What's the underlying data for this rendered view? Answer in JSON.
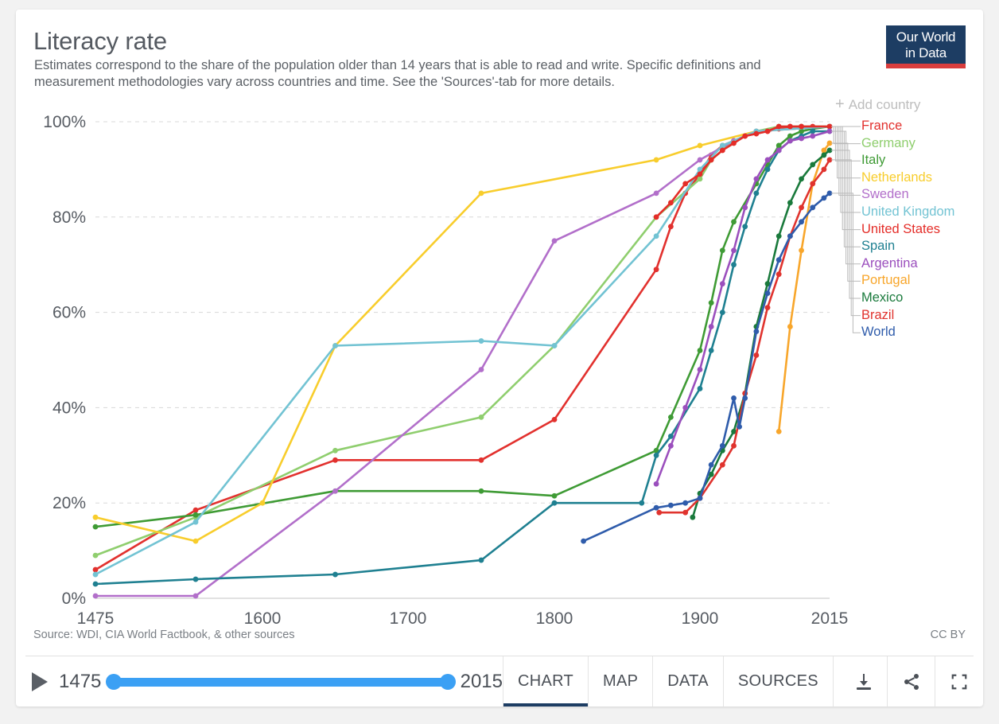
{
  "header": {
    "title": "Literacy rate",
    "subtitle": "Estimates correspond to the share of the population older than 14 years that is able to read and write. Specific definitions and measurement methodologies vary across countries and time. See the 'Sources'-tab for more details.",
    "logo_line1": "Our World",
    "logo_line2": "in Data"
  },
  "legend": {
    "add_country_label": "Add country",
    "add_icon": "plus-icon"
  },
  "footer": {
    "source": "Source: WDI, CIA World Factbook, & other sources",
    "license": "CC BY"
  },
  "controls": {
    "play_icon": "play-icon",
    "start_year": "1475",
    "end_year": "2015",
    "tabs": [
      {
        "label": "CHART",
        "active": true
      },
      {
        "label": "MAP",
        "active": false
      },
      {
        "label": "DATA",
        "active": false
      },
      {
        "label": "SOURCES",
        "active": false
      }
    ],
    "icons": [
      {
        "name": "download-icon"
      },
      {
        "name": "share-icon"
      },
      {
        "name": "fullscreen-icon"
      }
    ]
  },
  "chart_data": {
    "type": "line",
    "title": "Literacy rate",
    "xlabel": "",
    "ylabel": "",
    "xlim": [
      1475,
      2015
    ],
    "ylim": [
      0,
      100
    ],
    "grid": true,
    "legend_position": "right",
    "x_ticks": [
      1475,
      1600,
      1700,
      1800,
      1900,
      2015
    ],
    "x_tick_labels": [
      "1475",
      "1600",
      "1700",
      "1800",
      "1900",
      "2015"
    ],
    "y_ticks": [
      0,
      20,
      40,
      60,
      80,
      100
    ],
    "y_tick_labels": [
      "0%",
      "20%",
      "40%",
      "60%",
      "80%",
      "100%"
    ],
    "series": [
      {
        "name": "France",
        "color": "#e2312e",
        "points": [
          [
            1475,
            6
          ],
          [
            1550,
            18.5
          ],
          [
            1650,
            29
          ],
          [
            1750,
            29
          ],
          [
            1800,
            37.5
          ],
          [
            1870,
            69
          ],
          [
            1880,
            78
          ],
          [
            1890,
            85
          ],
          [
            1900,
            89
          ],
          [
            1910,
            93
          ],
          [
            1920,
            95
          ],
          [
            1930,
            96
          ],
          [
            1940,
            97
          ],
          [
            1950,
            97.5
          ],
          [
            1960,
            98
          ],
          [
            1970,
            98.5
          ],
          [
            1980,
            99
          ],
          [
            1990,
            99
          ],
          [
            2000,
            99
          ],
          [
            2015,
            99
          ]
        ]
      },
      {
        "name": "Germany",
        "color": "#8fce6e",
        "points": [
          [
            1475,
            9
          ],
          [
            1550,
            17
          ],
          [
            1650,
            31
          ],
          [
            1750,
            38
          ],
          [
            1800,
            53
          ],
          [
            1870,
            80
          ],
          [
            1900,
            88
          ],
          [
            1910,
            92
          ],
          [
            1930,
            96
          ],
          [
            1950,
            98
          ],
          [
            1970,
            99
          ],
          [
            1990,
            99
          ],
          [
            2015,
            99
          ]
        ]
      },
      {
        "name": "Italy",
        "color": "#3f9b35",
        "points": [
          [
            1475,
            15
          ],
          [
            1550,
            17.5
          ],
          [
            1650,
            22.5
          ],
          [
            1750,
            22.5
          ],
          [
            1800,
            21.5
          ],
          [
            1870,
            31
          ],
          [
            1880,
            38
          ],
          [
            1900,
            52
          ],
          [
            1910,
            62
          ],
          [
            1920,
            73
          ],
          [
            1930,
            79
          ],
          [
            1950,
            87
          ],
          [
            1960,
            91
          ],
          [
            1970,
            95
          ],
          [
            1980,
            97
          ],
          [
            1990,
            98
          ],
          [
            2000,
            98.5
          ],
          [
            2015,
            99
          ]
        ]
      },
      {
        "name": "Netherlands",
        "color": "#f8cd2c",
        "points": [
          [
            1475,
            17
          ],
          [
            1550,
            12
          ],
          [
            1600,
            20
          ],
          [
            1650,
            53
          ],
          [
            1750,
            85
          ],
          [
            1870,
            92
          ],
          [
            1900,
            95
          ],
          [
            1950,
            98
          ],
          [
            2015,
            99
          ]
        ]
      },
      {
        "name": "Sweden",
        "color": "#b26fca",
        "points": [
          [
            1475,
            0.5
          ],
          [
            1550,
            0.5
          ],
          [
            1650,
            22.5
          ],
          [
            1750,
            48
          ],
          [
            1800,
            75
          ],
          [
            1870,
            85
          ],
          [
            1900,
            92
          ],
          [
            1930,
            96
          ],
          [
            1950,
            98
          ],
          [
            2015,
            99
          ]
        ]
      },
      {
        "name": "United Kingdom",
        "color": "#72c3d3",
        "points": [
          [
            1475,
            5
          ],
          [
            1550,
            16
          ],
          [
            1650,
            53
          ],
          [
            1750,
            54
          ],
          [
            1800,
            53
          ],
          [
            1870,
            76
          ],
          [
            1900,
            90
          ],
          [
            1920,
            95
          ],
          [
            1950,
            98
          ],
          [
            2015,
            99
          ]
        ]
      },
      {
        "name": "United States",
        "color": "#e42d28",
        "points": [
          [
            1870,
            80
          ],
          [
            1880,
            83
          ],
          [
            1890,
            87
          ],
          [
            1900,
            89
          ],
          [
            1910,
            92
          ],
          [
            1920,
            94
          ],
          [
            1930,
            95.5
          ],
          [
            1940,
            97
          ],
          [
            1950,
            97.5
          ],
          [
            1960,
            98
          ],
          [
            1970,
            99
          ],
          [
            1980,
            99
          ],
          [
            1990,
            99
          ],
          [
            2015,
            99
          ]
        ]
      },
      {
        "name": "Spain",
        "color": "#1f8091",
        "points": [
          [
            1475,
            3
          ],
          [
            1550,
            4
          ],
          [
            1650,
            5
          ],
          [
            1750,
            8
          ],
          [
            1800,
            20
          ],
          [
            1860,
            20
          ],
          [
            1870,
            30
          ],
          [
            1880,
            34
          ],
          [
            1900,
            44
          ],
          [
            1910,
            52
          ],
          [
            1920,
            60
          ],
          [
            1930,
            70
          ],
          [
            1940,
            78
          ],
          [
            1950,
            85
          ],
          [
            1960,
            90
          ],
          [
            1970,
            94
          ],
          [
            1980,
            96
          ],
          [
            1990,
            97
          ],
          [
            2000,
            98
          ],
          [
            2015,
            98
          ]
        ]
      },
      {
        "name": "Argentina",
        "color": "#9b4fbd",
        "points": [
          [
            1870,
            24
          ],
          [
            1880,
            32
          ],
          [
            1890,
            40
          ],
          [
            1900,
            48
          ],
          [
            1910,
            57
          ],
          [
            1920,
            66
          ],
          [
            1930,
            73
          ],
          [
            1940,
            82
          ],
          [
            1950,
            88
          ],
          [
            1960,
            92
          ],
          [
            1970,
            94
          ],
          [
            1980,
            96
          ],
          [
            1990,
            96.5
          ],
          [
            2000,
            97
          ],
          [
            2015,
            98
          ]
        ]
      },
      {
        "name": "Portugal",
        "color": "#f8a62b",
        "points": [
          [
            1970,
            35
          ],
          [
            1980,
            57
          ],
          [
            1990,
            73
          ],
          [
            2000,
            87
          ],
          [
            2010,
            94
          ],
          [
            2015,
            95.5
          ]
        ]
      },
      {
        "name": "Mexico",
        "color": "#1a7a3c",
        "points": [
          [
            1895,
            17
          ],
          [
            1900,
            22
          ],
          [
            1910,
            26
          ],
          [
            1920,
            31
          ],
          [
            1930,
            35
          ],
          [
            1940,
            43
          ],
          [
            1950,
            57
          ],
          [
            1960,
            66
          ],
          [
            1970,
            76
          ],
          [
            1980,
            83
          ],
          [
            1990,
            88
          ],
          [
            2000,
            91
          ],
          [
            2010,
            93
          ],
          [
            2015,
            94
          ]
        ]
      },
      {
        "name": "Brazil",
        "color": "#e0332e",
        "points": [
          [
            1872,
            18
          ],
          [
            1890,
            18
          ],
          [
            1900,
            21
          ],
          [
            1920,
            28
          ],
          [
            1930,
            32
          ],
          [
            1940,
            43
          ],
          [
            1950,
            51
          ],
          [
            1960,
            61
          ],
          [
            1970,
            68
          ],
          [
            1980,
            76
          ],
          [
            1990,
            82
          ],
          [
            2000,
            87
          ],
          [
            2010,
            90
          ],
          [
            2015,
            92
          ]
        ]
      },
      {
        "name": "World",
        "color": "#2f5cab",
        "points": [
          [
            1820,
            12
          ],
          [
            1870,
            19
          ],
          [
            1880,
            19.5
          ],
          [
            1890,
            20
          ],
          [
            1900,
            21
          ],
          [
            1910,
            28
          ],
          [
            1920,
            32
          ],
          [
            1930,
            42
          ],
          [
            1935,
            36
          ],
          [
            1940,
            42
          ],
          [
            1950,
            56
          ],
          [
            1960,
            64
          ],
          [
            1970,
            71
          ],
          [
            1980,
            76
          ],
          [
            1990,
            79
          ],
          [
            2000,
            82
          ],
          [
            2010,
            84
          ],
          [
            2015,
            85
          ]
        ]
      }
    ],
    "legend_entries": [
      {
        "label": "France",
        "color": "#e2312e"
      },
      {
        "label": "Germany",
        "color": "#8fce6e"
      },
      {
        "label": "Italy",
        "color": "#3f9b35"
      },
      {
        "label": "Netherlands",
        "color": "#f8cd2c"
      },
      {
        "label": "Sweden",
        "color": "#b26fca"
      },
      {
        "label": "United Kingdom",
        "color": "#72c3d3"
      },
      {
        "label": "United States",
        "color": "#e42d28"
      },
      {
        "label": "Spain",
        "color": "#1f8091"
      },
      {
        "label": "Argentina",
        "color": "#9b4fbd"
      },
      {
        "label": "Portugal",
        "color": "#f8a62b"
      },
      {
        "label": "Mexico",
        "color": "#1a7a3c"
      },
      {
        "label": "Brazil",
        "color": "#e0332e"
      },
      {
        "label": "World",
        "color": "#2f5cab"
      }
    ]
  }
}
